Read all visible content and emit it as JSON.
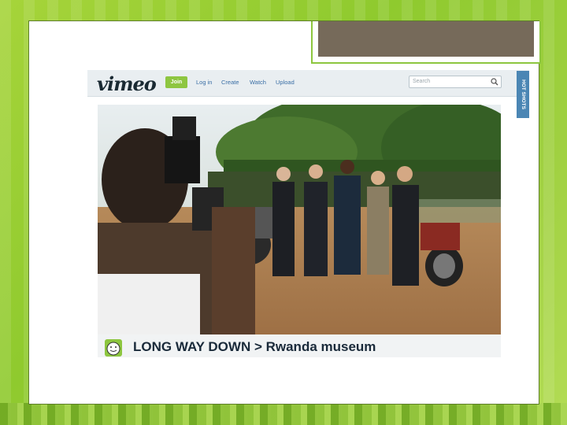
{
  "vimeo": {
    "logo": "vimeo",
    "join_label": "Join",
    "nav": [
      "Log in",
      "Create",
      "Watch",
      "Upload"
    ],
    "search_placeholder": "Search",
    "side_tab_label": "HOT SHOTS"
  },
  "caption": {
    "text": "LONG WAY DOWN > Rwanda museum"
  },
  "icons": [
    "search-icon",
    "face-icon"
  ],
  "colors": {
    "background_green": "#9fd040",
    "vimeo_green": "#8ec641",
    "title_box_fill": "#766a5a"
  }
}
